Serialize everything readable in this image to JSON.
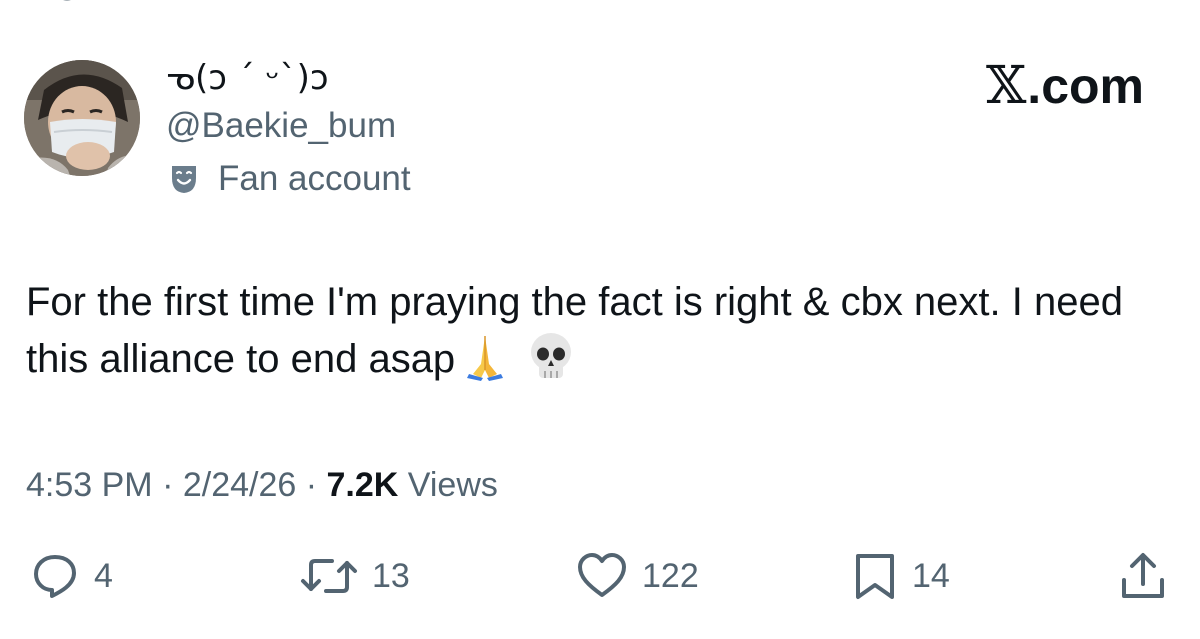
{
  "user": {
    "display_name": "ᓀ(ɔ ´ ᵕ`)ɔ",
    "handle": "@Baekie_bum",
    "label": "Fan account",
    "label_icon": "theater-mask-icon",
    "avatar": "profile-photo-person-with-face-mask"
  },
  "brand": {
    "x_glyph": "𝕏",
    "suffix": ".com"
  },
  "tweet": {
    "text": "For the first time I'm praying the fact is right & cbx next. I need this alliance to end asap",
    "emojis": [
      "folded-hands-icon",
      "skull-icon"
    ]
  },
  "meta": {
    "time": "4:53 PM",
    "separator": " · ",
    "date": "2/24/26",
    "views_count": "7.2K",
    "views_label": " Views"
  },
  "actions": {
    "reply_count": "4",
    "retweet_count": "13",
    "like_count": "122",
    "bookmark_count": "14"
  },
  "colors": {
    "text_primary": "#0f1419",
    "text_secondary": "#536471",
    "background": "#ffffff"
  }
}
